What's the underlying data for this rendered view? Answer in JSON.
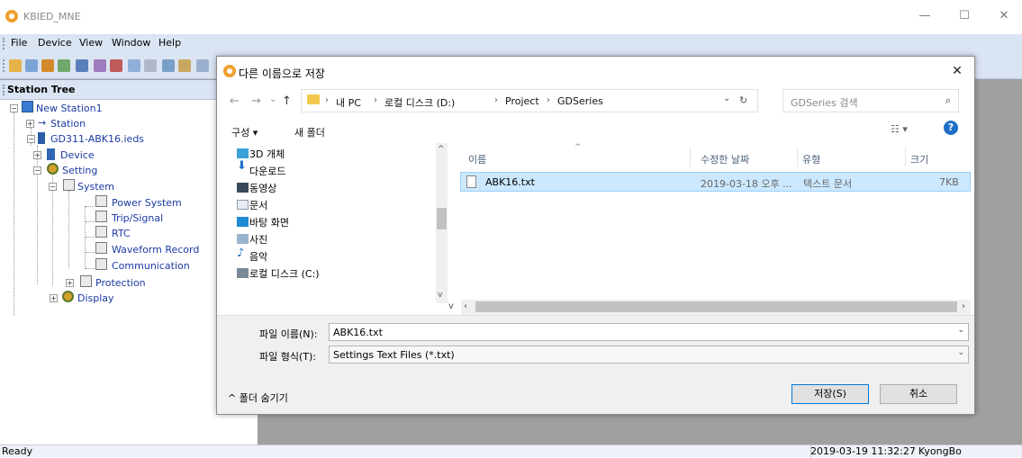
{
  "app": {
    "title": "KBIED_MNE",
    "window_controls": {
      "minimize": "—",
      "maximize": "☐",
      "close": "✕"
    },
    "menu": [
      "File",
      "Device",
      "View",
      "Window",
      "Help"
    ]
  },
  "station_tree": {
    "title": "Station Tree",
    "nodes": {
      "root": "New Station1",
      "station": "Station",
      "ied": "GD311-ABK16.ieds",
      "device": "Device",
      "setting": "Setting",
      "system": "System",
      "power_system": "Power System",
      "trip_signal": "Trip/Signal",
      "rtc": "RTC",
      "waveform": "Waveform Record",
      "communication": "Communication",
      "protection": "Protection",
      "display": "Display"
    }
  },
  "status": {
    "left": "Ready",
    "datetime": "2019-03-19 11:32:27",
    "user": "KyongBo"
  },
  "dialog": {
    "title": "다른 이름으로 저장",
    "close": "✕",
    "nav": {
      "back": "←",
      "forward": "→",
      "recent": "⌄",
      "up": "↑"
    },
    "breadcrumb": [
      "내 PC",
      "로컬 디스크 (D:)",
      "Project",
      "GDSeries"
    ],
    "search_placeholder": "GDSeries 검색",
    "commands": {
      "organize": "구성 ▾",
      "new_folder": "새 폴더"
    },
    "left_nav": [
      "3D 개체",
      "다운로드",
      "동영상",
      "문서",
      "바탕 화면",
      "사진",
      "음악",
      "로컬 디스크 (C:)"
    ],
    "columns": {
      "name": "이름",
      "modified": "수정한 날짜",
      "type": "유형",
      "size": "크기"
    },
    "files": [
      {
        "name": "ABK16.txt",
        "modified": "2019-03-18 오후 ...",
        "type": "텍스트 문서",
        "size": "7KB"
      }
    ],
    "filename_label": "파일 이름(N):",
    "filename_value": "ABK16.txt",
    "filetype_label": "파일 형식(T):",
    "filetype_value": "Settings Text Files (*.txt)",
    "hide_folders": "^ 폴더 숨기기",
    "save_button": "저장(S)",
    "cancel_button": "취소"
  }
}
